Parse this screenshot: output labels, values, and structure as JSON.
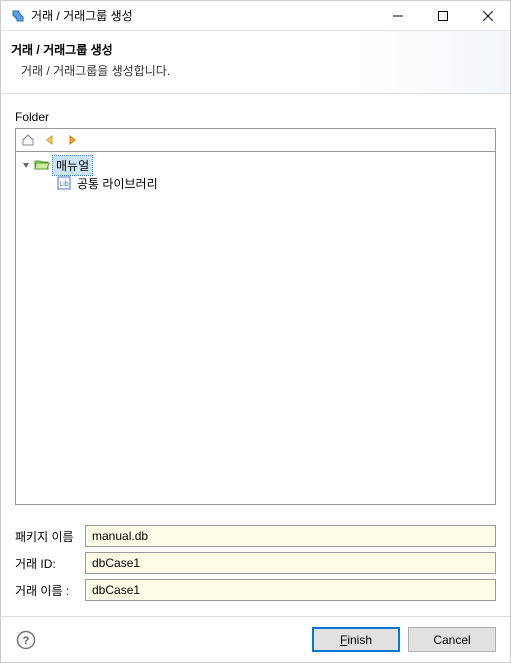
{
  "titlebar": {
    "title": "거래 / 거래그룹 생성"
  },
  "header": {
    "title": "거래 / 거래그룹 생성",
    "description": "거래 / 거래그룹을 생성합니다."
  },
  "folder": {
    "label": "Folder",
    "tree": {
      "root": {
        "label": "매뉴얼"
      },
      "child": {
        "label": "공통 라이브러리"
      }
    }
  },
  "form": {
    "package_label": "패키지 이름",
    "package_value": "manual.db",
    "txid_label": "거래 ID:",
    "txid_value": "dbCase1",
    "txname_label": "거래 이름  :",
    "txname_value": "dbCase1"
  },
  "footer": {
    "finish": "Finish",
    "cancel": "Cancel"
  }
}
